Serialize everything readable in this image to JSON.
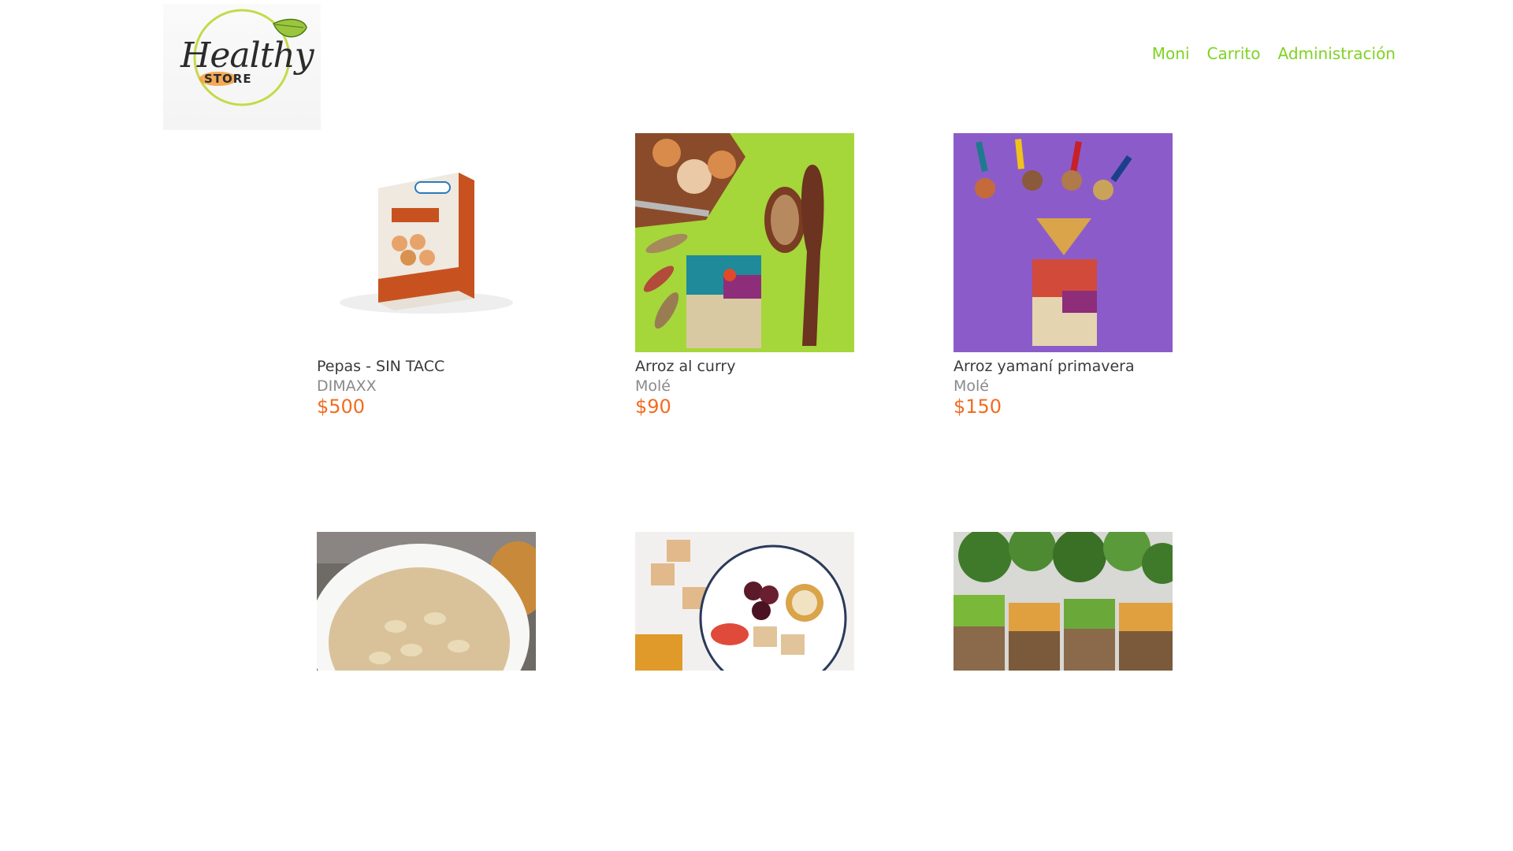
{
  "header": {
    "logo": {
      "title": "Healthy",
      "subtitle": "STORE"
    },
    "nav": [
      {
        "label": "Moni"
      },
      {
        "label": "Carrito"
      },
      {
        "label": "Administración"
      }
    ]
  },
  "products": [
    {
      "name": "Pepas - SIN TACC",
      "brand": "DIMAXX",
      "price": "$500"
    },
    {
      "name": "Arroz al curry",
      "brand": "Molé",
      "price": "$90"
    },
    {
      "name": "Arroz yamaní primavera",
      "brand": "Molé",
      "price": "$150"
    }
  ],
  "colors": {
    "nav": "#7ed321",
    "price": "#f26c21",
    "name": "#3a3a3a",
    "brand": "#8a8a8a"
  }
}
